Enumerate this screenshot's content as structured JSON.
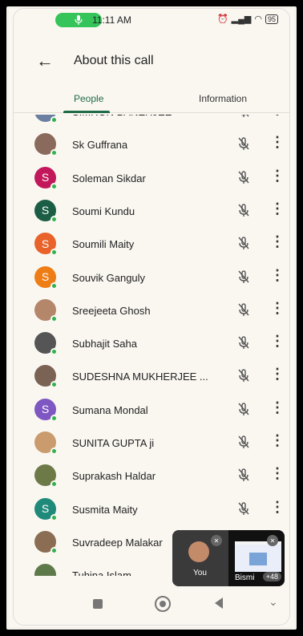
{
  "status": {
    "time": "11:11 AM",
    "battery": "95",
    "icons": [
      "alarm-icon",
      "signal-icon",
      "wifi-icon"
    ]
  },
  "header": {
    "title": "About this call",
    "back_icon": "arrow-left-icon"
  },
  "tabs": [
    {
      "label": "People",
      "active": true
    },
    {
      "label": "Information",
      "active": false
    }
  ],
  "participants": [
    {
      "name": "SIMRON BANERJEE",
      "avatar": "photo",
      "color": "#6b7fa0"
    },
    {
      "name": "Sk Guffrana",
      "avatar": "photo",
      "color": "#8a6a5c"
    },
    {
      "name": "Soleman Sikdar",
      "avatar": "S",
      "color": "#c2185b"
    },
    {
      "name": "Soumi Kundu",
      "avatar": "S",
      "color": "#1b5e45"
    },
    {
      "name": "Soumili Maity",
      "avatar": "S",
      "color": "#e8622a"
    },
    {
      "name": "Souvik Ganguly",
      "avatar": "S",
      "color": "#ef7d16"
    },
    {
      "name": "Sreejeeta Ghosh",
      "avatar": "photo",
      "color": "#b4876a"
    },
    {
      "name": "Subhajit Saha",
      "avatar": "photo",
      "color": "#555555"
    },
    {
      "name": "SUDESHNA MUKHERJEE ...",
      "avatar": "photo",
      "color": "#7a6255"
    },
    {
      "name": "Sumana Mondal",
      "avatar": "S",
      "color": "#7e57c2"
    },
    {
      "name": "SUNITA GUPTA ji",
      "avatar": "photo",
      "color": "#c99b6d"
    },
    {
      "name": "Suprakash Haldar",
      "avatar": "photo",
      "color": "#6d7a48"
    },
    {
      "name": "Susmita Maity",
      "avatar": "S",
      "color": "#1f8a7a"
    },
    {
      "name": "Suvradeep Malakar",
      "avatar": "photo",
      "color": "#8a6d52"
    },
    {
      "name": "Tuhina Islam",
      "avatar": "photo",
      "color": "#5f7a4a"
    }
  ],
  "pip": {
    "self_label": "You",
    "other_name": "Bismi",
    "count": "+48"
  }
}
